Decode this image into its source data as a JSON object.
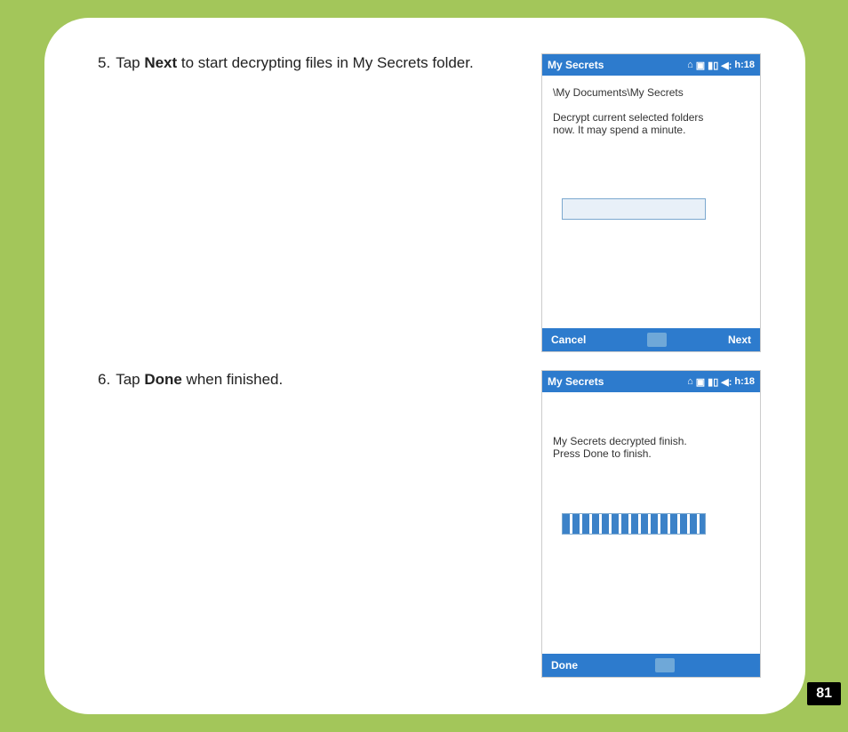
{
  "page_number": "81",
  "step5": {
    "number": "5.",
    "prefix": "Tap ",
    "bold": "Next",
    "suffix": " to start decrypting files in My Secrets folder."
  },
  "step6": {
    "number": "6.",
    "prefix": "Tap ",
    "bold": "Done",
    "suffix": " when finished."
  },
  "screen1": {
    "title": "My Secrets",
    "time": "h:18",
    "path": "\\My Documents\\My Secrets",
    "message": "Decrypt current selected folders now. It may spend a minute.",
    "footer_left": "Cancel",
    "footer_right": "Next"
  },
  "screen2": {
    "title": "My Secrets",
    "time": "h:18",
    "message": "My Secrets decrypted finish. Press Done to finish.",
    "footer_left": "Done",
    "footer_right": ""
  }
}
